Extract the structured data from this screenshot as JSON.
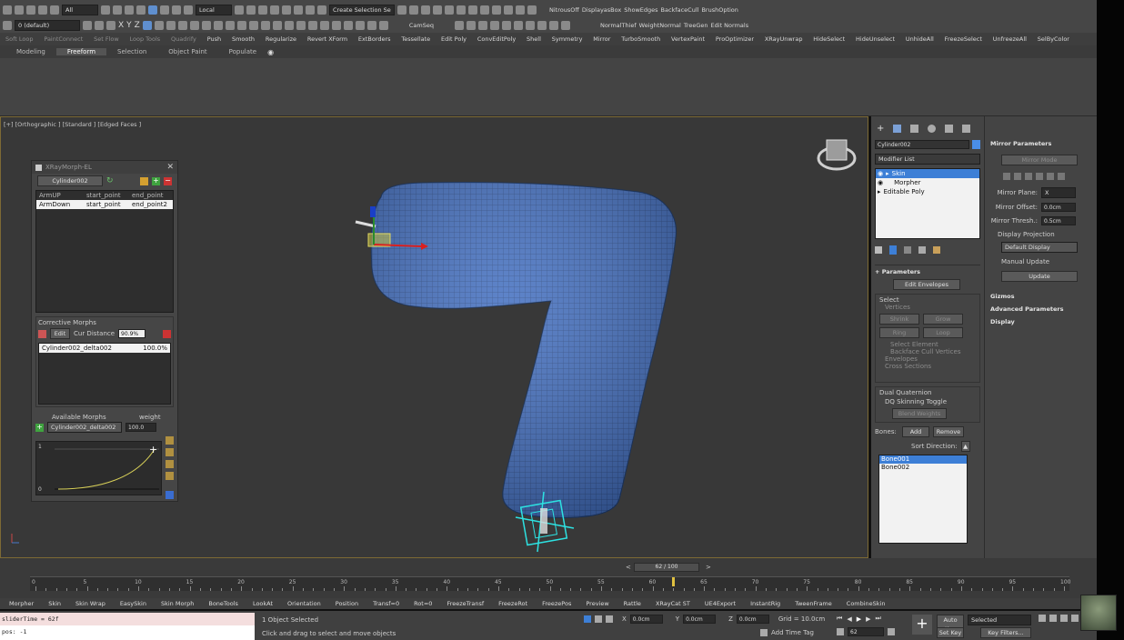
{
  "toolbar": {
    "selection_filter": "All",
    "coordinate_system": "Local",
    "named_selection": "Create Selection Se",
    "layer": "0 (default)",
    "xyz": [
      "X",
      "Y",
      "Z"
    ],
    "quick_items": [
      "NitrousOff",
      "DisplayasBox",
      "ShowEdges",
      "BackfaceCull",
      "BrushOption"
    ],
    "row3": [
      "Soft Loop",
      "PaintConnect",
      "Set Flow",
      "Loop Tools",
      "Quadrify",
      "Push",
      "Smooth",
      "Regularize",
      "Revert XForm",
      "ExtBorders",
      "Tessellate",
      "Edit Poly",
      "ConvEditPoly",
      "Shell",
      "Symmetry",
      "Mirror",
      "TurboSmooth",
      "VertexPaint",
      "ProOptimizer",
      "XRayUnwrap",
      "HideSelect",
      "HideUnselect",
      "UnhideAll",
      "FreezeSelect",
      "UnfreezeAll",
      "SelByColor"
    ],
    "row2_right": [
      "NormalThief",
      "WeightNormal",
      "TreeGen",
      "Edit Normals"
    ],
    "camseq": "CamSeq"
  },
  "ribbon_tabs": [
    {
      "label": "Modeling",
      "active": false
    },
    {
      "label": "Freeform",
      "active": true
    },
    {
      "label": "Selection",
      "active": false
    },
    {
      "label": "Object Paint",
      "active": false
    },
    {
      "label": "Populate",
      "active": false
    }
  ],
  "viewport": {
    "label": "[+] [Orthographic ] [Standard ] [Edged Faces ]"
  },
  "xray_morph": {
    "title": "XRayMorph-EL",
    "object_button": "Cylinder002",
    "columns": [
      "ArmUP",
      "start_point",
      "end_point"
    ],
    "rows": [
      [
        "ArmDown",
        "start_point",
        "end_point2"
      ]
    ],
    "corrective_label": "Corrective Morphs",
    "edit_button": "Edit",
    "cur_distance_label": "Cur Distance",
    "cur_distance_value": "90.9%",
    "corrective_items": [
      {
        "name": "Cylinder002_delta002",
        "value": "100.0%"
      }
    ],
    "available_label": "Available Morphs",
    "weight_label": "weight",
    "available_value": "Cylinder002_delta002",
    "weight_value": "100.0",
    "curve_y_top": "1",
    "curve_y_bottom": "0"
  },
  "command_panel": {
    "object_name": "Cylinder002",
    "modifier_list": "Modifier List",
    "stack": [
      "Skin",
      "Morpher",
      "Editable Poly"
    ],
    "parameters_title": "Parameters",
    "edit_envelopes": "Edit Envelopes",
    "select_label": "Select",
    "vertices": "Vertices",
    "shrink": "Shrink",
    "grow": "Grow",
    "ring": "Ring",
    "loop": "Loop",
    "select_element": "Select Element",
    "backface_cull": "Backface Cull Vertices",
    "envelopes": "Envelopes",
    "cross_sections": "Cross Sections",
    "dual_quat_label": "Dual Quaternion",
    "dq_toggle": "DQ Skinning Toggle",
    "blend_weights": "Blend Weights",
    "bones_label": "Bones:",
    "add": "Add",
    "remove": "Remove",
    "sort_direction": "Sort Direction:",
    "bones": [
      "Bone001",
      "Bone002"
    ]
  },
  "mirror_rollout": {
    "title": "Mirror Parameters",
    "mirror_mode": "Mirror Mode",
    "mirror_plane_label": "Mirror Plane:",
    "mirror_plane_value": "X",
    "mirror_offset_label": "Mirror Offset:",
    "mirror_offset_value": "0.0cm",
    "mirror_thresh_label": "Mirror Thresh.:",
    "mirror_thresh_value": "0.5cm",
    "display_projection": "Display Projection",
    "default_display": "Default Display",
    "manual_update": "Manual Update",
    "update": "Update",
    "gizmos": "Gizmos",
    "advanced": "Advanced Parameters",
    "display": "Display"
  },
  "timeline": {
    "slider": "62 / 100",
    "current_frame": 62,
    "total_frames": 100,
    "ticks": [
      "0",
      "5",
      "10",
      "15",
      "20",
      "25",
      "30",
      "35",
      "40",
      "45",
      "50",
      "55",
      "60",
      "65",
      "70",
      "75",
      "80",
      "85",
      "90",
      "95",
      "100"
    ]
  },
  "bottom_tabs": [
    "Morpher",
    "Skin",
    "Skin Wrap",
    "EasySkin",
    "Skin Morph",
    "BoneTools",
    "LookAt",
    "Orientation",
    "Position",
    "Transf=0",
    "Rot=0",
    "FreezeTransf",
    "FreezeRot",
    "FreezePos",
    "Preview",
    "Rattle",
    "XRayCat ST",
    "UE4Export",
    "InstantRig",
    "TweenFrame",
    "CombineSkin"
  ],
  "status": {
    "listener_line1": "sliderTime = 62f",
    "listener_line2": "pos: -1",
    "selected": "1 Object Selected",
    "hint": "Click and drag to select and move objects",
    "x": "0.0cm",
    "y": "0.0cm",
    "z": "0.0cm",
    "grid": "Grid = 10.0cm",
    "add_time_tag": "Add Time Tag",
    "frame_field": "62",
    "auto_key": "Auto Key",
    "set_key": "Set Key",
    "selected_dd": "Selected",
    "key_filters": "Key Filters..."
  },
  "colors": {
    "accent": "#5b9bdb",
    "mesh": "#3b6cc4",
    "viewport_border": "#8a7433"
  }
}
